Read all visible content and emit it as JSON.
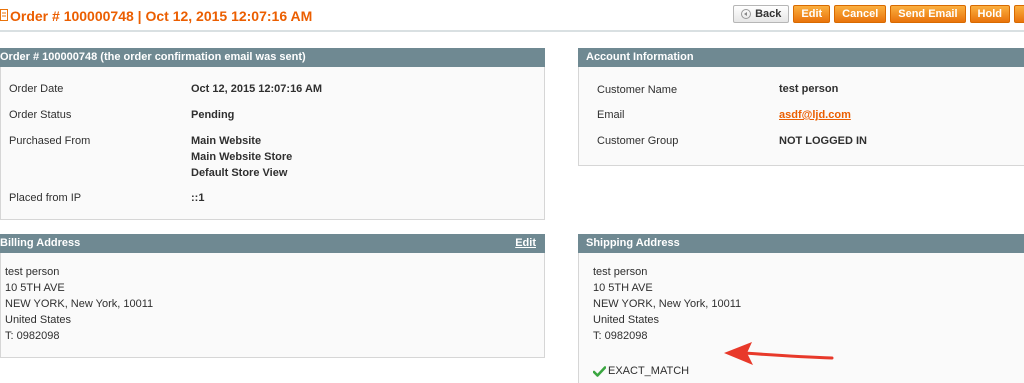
{
  "header": {
    "title": "Order # 100000748 | Oct 12, 2015 12:07:16 AM",
    "buttons": {
      "back": "Back",
      "edit": "Edit",
      "cancel": "Cancel",
      "send_email": "Send Email",
      "hold": "Hold"
    }
  },
  "order": {
    "heading": "Order # 100000748 (the order confirmation email was sent)",
    "rows": {
      "date_label": "Order Date",
      "date_value": "Oct 12, 2015 12:07:16 AM",
      "status_label": "Order Status",
      "status_value": "Pending",
      "purchased_label": "Purchased From",
      "purchased_lines": [
        "Main Website",
        "Main Website Store",
        "Default Store View"
      ],
      "ip_label": "Placed from IP",
      "ip_value": "::1"
    }
  },
  "account": {
    "heading": "Account Information",
    "name_label": "Customer Name",
    "name_value": "test person",
    "email_label": "Email",
    "email_value": "asdf@ljd.com",
    "group_label": "Customer Group",
    "group_value": "NOT LOGGED IN"
  },
  "billing": {
    "heading": "Billing Address",
    "edit_label": "Edit",
    "lines": [
      "test person",
      "10 5TH AVE",
      "NEW YORK, New York, 10011",
      "United States",
      "T: 0982098"
    ]
  },
  "shipping": {
    "heading": "Shipping Address",
    "lines": [
      "test person",
      "10 5TH AVE",
      "NEW YORK, New York, 10011",
      "United States",
      "T: 0982098"
    ],
    "match_text": "EXACT_MATCH"
  },
  "colors": {
    "accent": "#eb5e00",
    "header_bar": "#6f8992",
    "arrow": "#e8392a",
    "check": "#3aa640"
  }
}
